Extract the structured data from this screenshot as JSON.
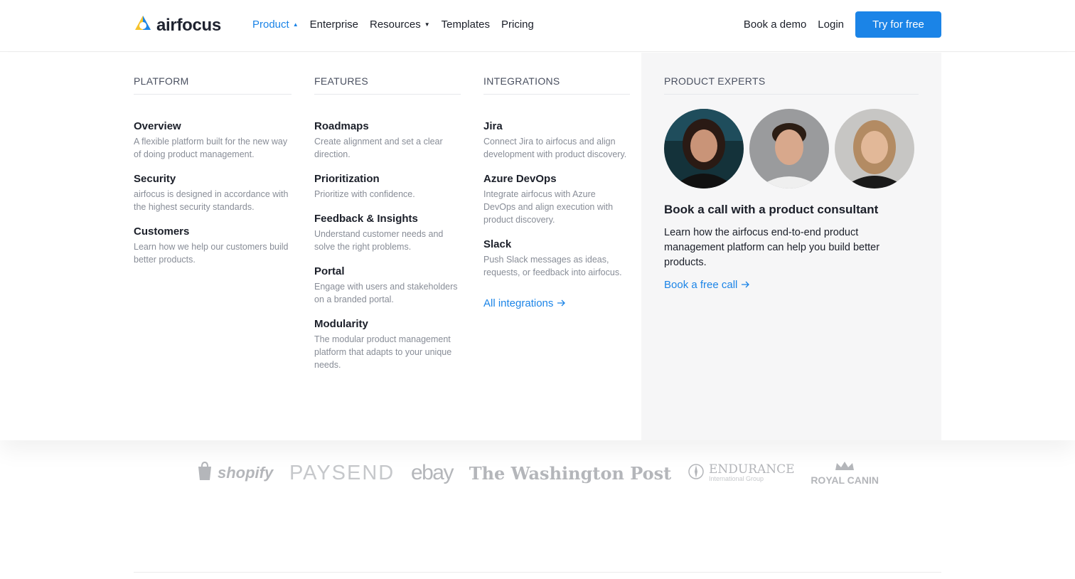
{
  "header": {
    "logo_text": "airfocus",
    "nav": [
      {
        "label": "Product",
        "active": true,
        "caret": "▲"
      },
      {
        "label": "Enterprise"
      },
      {
        "label": "Resources",
        "caret": "▼"
      },
      {
        "label": "Templates"
      },
      {
        "label": "Pricing"
      }
    ],
    "book_demo": "Book a demo",
    "login": "Login",
    "cta": "Try for free"
  },
  "menu": {
    "platform": {
      "heading": "PLATFORM",
      "items": [
        {
          "title": "Overview",
          "desc": "A flexible platform built for the new way of doing product management."
        },
        {
          "title": "Security",
          "desc": "airfocus is designed in accordance with the highest security standards."
        },
        {
          "title": "Customers",
          "desc": "Learn how we help our customers build better products."
        }
      ]
    },
    "features": {
      "heading": "FEATURES",
      "items": [
        {
          "title": "Roadmaps",
          "desc": "Create alignment and set a clear direction."
        },
        {
          "title": "Prioritization",
          "desc": "Prioritize with confidence."
        },
        {
          "title": "Feedback & Insights",
          "desc": "Understand customer needs and solve the right problems."
        },
        {
          "title": "Portal",
          "desc": "Engage with users and stakeholders on a branded portal."
        },
        {
          "title": "Modularity",
          "desc": "The modular product management platform that adapts to your unique needs."
        }
      ]
    },
    "integrations": {
      "heading": "INTEGRATIONS",
      "items": [
        {
          "title": "Jira",
          "desc": "Connect Jira to airfocus and align development with product discovery."
        },
        {
          "title": "Azure DevOps",
          "desc": "Integrate airfocus with Azure DevOps and align execution with product discovery."
        },
        {
          "title": "Slack",
          "desc": "Push Slack messages as ideas, requests, or feedback into airfocus."
        }
      ],
      "link": "All integrations"
    },
    "experts": {
      "heading": "PRODUCT EXPERTS",
      "title": "Book a call with a product consultant",
      "desc": "Learn how the airfocus end-to-end product management platform can help you build better products.",
      "link": "Book a free call",
      "link_arrow": "→"
    }
  },
  "logos": {
    "shopify": "shopify",
    "paysend": "PAYSEND",
    "ebay": "ebay",
    "wapo": "The Washington Post",
    "endurance": "ENDURANCE",
    "endurance_sub": "International Group",
    "royal_canin": "ROYAL CANIN"
  },
  "colors": {
    "accent": "#1b84e7",
    "experts_bg": "#f6f6f7",
    "muted_text": "#888d97"
  }
}
